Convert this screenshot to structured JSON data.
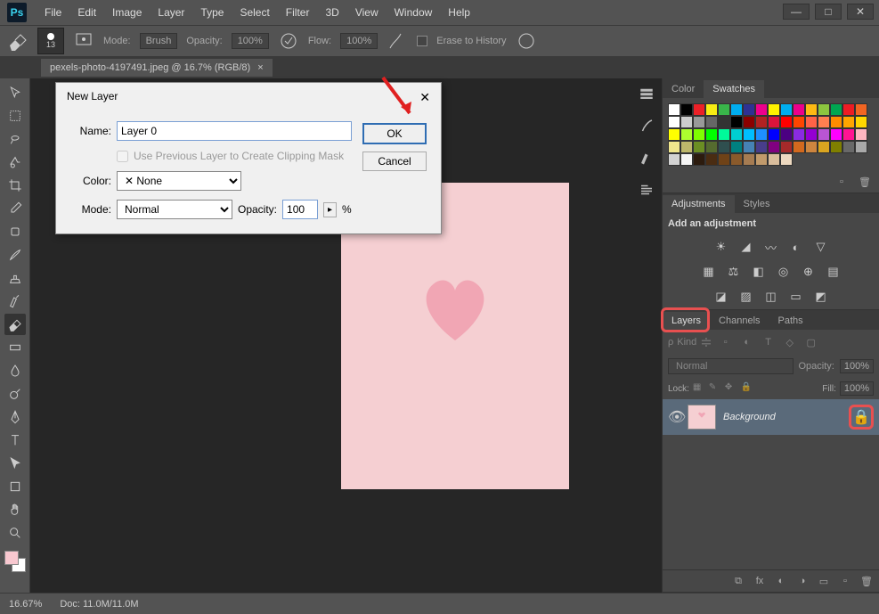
{
  "menu": [
    "File",
    "Edit",
    "Image",
    "Layer",
    "Type",
    "Select",
    "Filter",
    "3D",
    "View",
    "Window",
    "Help"
  ],
  "options_bar": {
    "brush_size": "13",
    "mode_label": "Mode:",
    "mode_value": "Brush",
    "opacity_label": "Opacity:",
    "opacity_value": "100%",
    "flow_label": "Flow:",
    "flow_value": "100%",
    "erase_history": "Erase to History"
  },
  "document": {
    "tab_title": "pexels-photo-4197491.jpeg @ 16.7% (RGB/8)"
  },
  "dialog": {
    "title": "New Layer",
    "name_label": "Name:",
    "name_value": "Layer 0",
    "prev_mask": "Use Previous Layer to Create Clipping Mask",
    "color_label": "Color:",
    "color_value": "None",
    "mode_label": "Mode:",
    "mode_value": "Normal",
    "opacity_label": "Opacity:",
    "opacity_value": "100",
    "opacity_pct": "%",
    "ok": "OK",
    "cancel": "Cancel"
  },
  "panels": {
    "color_tab": "Color",
    "swatches_tab": "Swatches",
    "adjustments_tab": "Adjustments",
    "styles_tab": "Styles",
    "add_adjustment": "Add an adjustment",
    "layers_tab": "Layers",
    "channels_tab": "Channels",
    "paths_tab": "Paths",
    "kind_label": "Kind",
    "blend_mode": "Normal",
    "opacity_label": "Opacity:",
    "opacity_value": "100%",
    "lock_label": "Lock:",
    "fill_label": "Fill:",
    "fill_value": "100%",
    "background_layer": "Background"
  },
  "status": {
    "zoom": "16.67%",
    "doc": "Doc: 11.0M/11.0M"
  },
  "swatch_colors": [
    "#ffffff",
    "#000000",
    "#ec2027",
    "#f7ec13",
    "#39b54a",
    "#00adef",
    "#2e3192",
    "#ed008c",
    "#fff200",
    "#00aeef",
    "#ec008c",
    "#fdb913",
    "#8cc63f",
    "#00a651",
    "#ed1c24",
    "#f26522",
    "#fff",
    "#ccc",
    "#999",
    "#666",
    "#333",
    "#000",
    "#8b0000",
    "#b22222",
    "#dc143c",
    "#ff0000",
    "#ff4500",
    "#ff6347",
    "#ff7f50",
    "#ff8c00",
    "#ffa500",
    "#ffd700",
    "#ffff00",
    "#adff2f",
    "#7fff00",
    "#00ff00",
    "#00fa9a",
    "#00ced1",
    "#00bfff",
    "#1e90ff",
    "#0000ff",
    "#4b0082",
    "#8a2be2",
    "#9400d3",
    "#ba55d3",
    "#ff00ff",
    "#ff1493",
    "#ffb6c1",
    "#f0e68c",
    "#bdb76b",
    "#6b8e23",
    "#556b2f",
    "#2f4f4f",
    "#008080",
    "#4682b4",
    "#483d8b",
    "#800080",
    "#a52a2a",
    "#d2691e",
    "#cd853f",
    "#daa520",
    "#808000",
    "#696969",
    "#a9a9a9",
    "#d3d3d3",
    "#f5f5f5",
    "#2c1b0e",
    "#4a2c12",
    "#6f4217",
    "#8a5a2b",
    "#a67c52",
    "#c19a6b",
    "#d9bd9c",
    "#edd9c0"
  ]
}
